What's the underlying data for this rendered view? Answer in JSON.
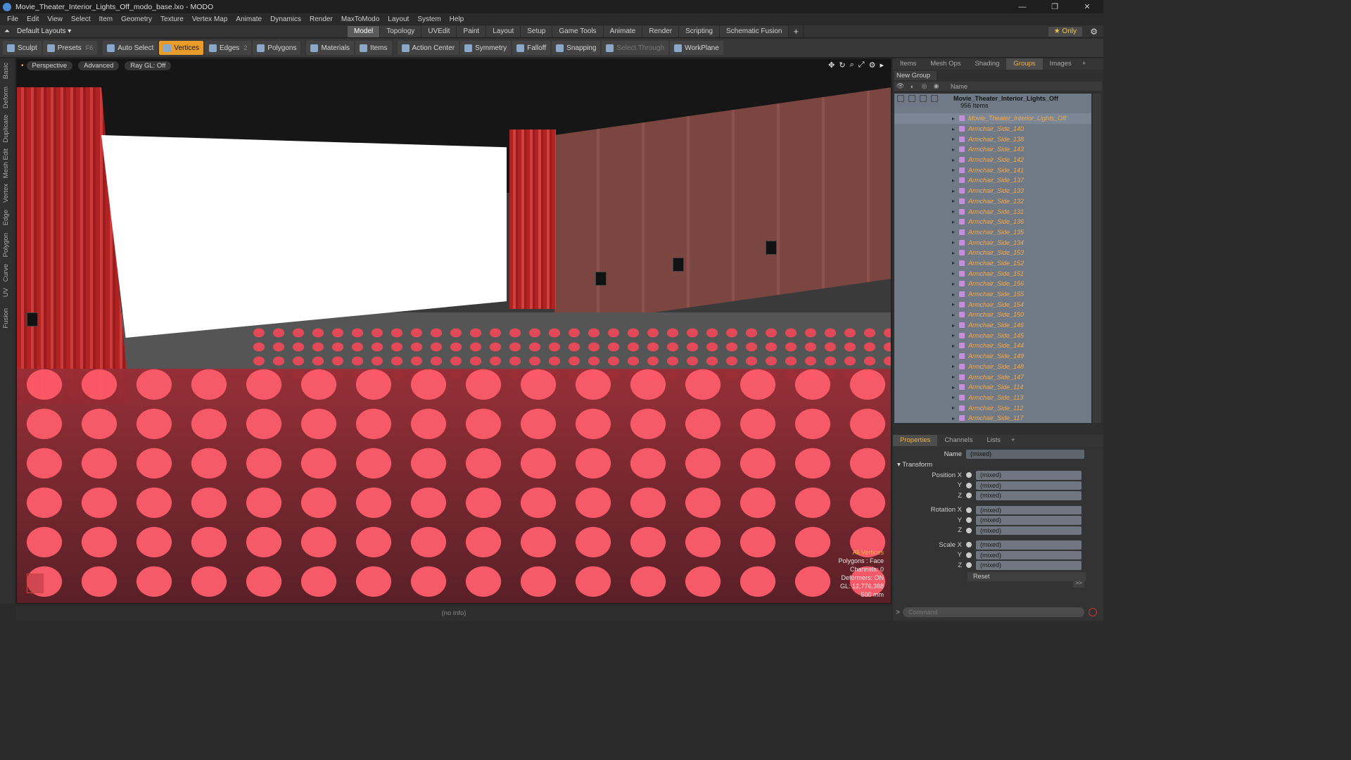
{
  "window": {
    "title": "Movie_Theater_Interior_Lights_Off_modo_base.lxo - MODO",
    "controls": [
      "—",
      "❐",
      "✕"
    ]
  },
  "menu": [
    "File",
    "Edit",
    "View",
    "Select",
    "Item",
    "Geometry",
    "Texture",
    "Vertex Map",
    "Animate",
    "Dynamics",
    "Render",
    "MaxToModo",
    "Layout",
    "System",
    "Help"
  ],
  "layout": {
    "selector": "Default Layouts ▾",
    "tabs": [
      "Model",
      "Topology",
      "UVEdit",
      "Paint",
      "Layout",
      "Setup",
      "Game Tools",
      "Animate",
      "Render",
      "Scripting",
      "Schematic Fusion"
    ],
    "active_tab": "Model",
    "only_label": "★  Only"
  },
  "toolbar": {
    "sculpt": "Sculpt",
    "presets": "Presets",
    "presets_key": "F6",
    "auto_select": "Auto Select",
    "vertices": "Vertices",
    "edges": "Edges",
    "edges_count": "2",
    "polygons": "Polygons",
    "materials": "Materials",
    "items": "Items",
    "action_center": "Action Center",
    "symmetry": "Symmetry",
    "falloff": "Falloff",
    "snapping": "Snapping",
    "select_through": "Select Through",
    "workplane": "WorkPlane"
  },
  "left_tabs": [
    "Basic",
    "Deform",
    "Duplicate",
    "Mesh Edit",
    "Vertex",
    "Edge",
    "Polygon",
    "Curve",
    "UV",
    "Fusion"
  ],
  "viewport": {
    "view": "Perspective",
    "style": "Advanced",
    "raygl": "Ray GL: Off",
    "hud": [
      "All Vertices",
      "Polygons : Face",
      "Channels: 0",
      "Deformers: ON",
      "GL: 12,776,388",
      "500 mm"
    ]
  },
  "status": "(no info)",
  "right_tabs": [
    "Items",
    "Mesh Ops",
    "Shading",
    "Groups",
    "Images"
  ],
  "right_active": "Groups",
  "groups": {
    "new_group": "New Group",
    "name_header": "Name",
    "root_name": "Movie_Theater_Interior_Lights_Off",
    "root_count": "956 Items",
    "items": [
      "Movie_Theater_Interior_Lights_Off",
      "Armchair_Side_140",
      "Armchair_Side_138",
      "Armchair_Side_143",
      "Armchair_Side_142",
      "Armchair_Side_141",
      "Armchair_Side_137",
      "Armchair_Side_133",
      "Armchair_Side_132",
      "Armchair_Side_131",
      "Armchair_Side_136",
      "Armchair_Side_135",
      "Armchair_Side_134",
      "Armchair_Side_153",
      "Armchair_Side_152",
      "Armchair_Side_151",
      "Armchair_Side_156",
      "Armchair_Side_155",
      "Armchair_Side_154",
      "Armchair_Side_150",
      "Armchair_Side_146",
      "Armchair_Side_145",
      "Armchair_Side_144",
      "Armchair_Side_149",
      "Armchair_Side_148",
      "Armchair_Side_147",
      "Armchair_Side_114",
      "Armchair_Side_113",
      "Armchair_Side_112",
      "Armchair_Side_117"
    ]
  },
  "props_tabs": [
    "Properties",
    "Channels",
    "Lists"
  ],
  "properties": {
    "name_label": "Name",
    "name_value": "(mixed)",
    "transform": "▾ Transform",
    "position": [
      {
        "label": "Position X",
        "value": "(mixed)"
      },
      {
        "label": "Y",
        "value": "(mixed)"
      },
      {
        "label": "Z",
        "value": "(mixed)"
      }
    ],
    "rotation": [
      {
        "label": "Rotation X",
        "value": "(mixed)"
      },
      {
        "label": "Y",
        "value": "(mixed)"
      },
      {
        "label": "Z",
        "value": "(mixed)"
      }
    ],
    "scale": [
      {
        "label": "Scale X",
        "value": "(mixed)"
      },
      {
        "label": "Y",
        "value": "(mixed)"
      },
      {
        "label": "Z",
        "value": "(mixed)"
      }
    ],
    "reset": "Reset",
    "more": ">>"
  },
  "command": {
    "placeholder": "Command",
    "arrow": ">"
  },
  "colors": {
    "accent": "#e89c2c",
    "selected_item": "#f6a84a"
  }
}
